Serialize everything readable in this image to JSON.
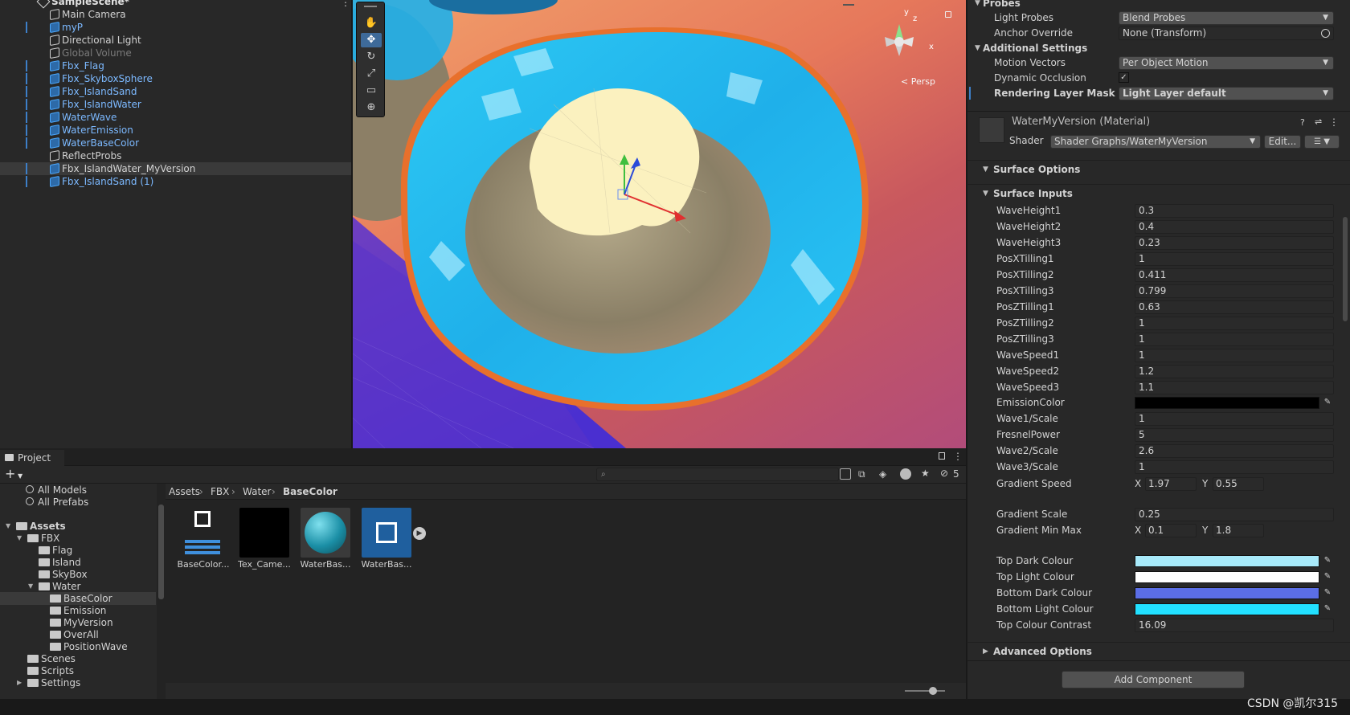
{
  "hierarchy": {
    "scene_name": "SampleScene*",
    "items": [
      {
        "label": "Main Camera",
        "style": "normal"
      },
      {
        "label": "myP",
        "style": "blue"
      },
      {
        "label": "Directional Light",
        "style": "normal"
      },
      {
        "label": "Global Volume",
        "style": "gray"
      },
      {
        "label": "Fbx_Flag",
        "style": "blue"
      },
      {
        "label": "Fbx_SkyboxSphere",
        "style": "blue"
      },
      {
        "label": "Fbx_IslandSand",
        "style": "blue"
      },
      {
        "label": "Fbx_IslandWater",
        "style": "blue"
      },
      {
        "label": "WaterWave",
        "style": "blue"
      },
      {
        "label": "WaterEmission",
        "style": "blue"
      },
      {
        "label": "WaterBaseColor",
        "style": "blue"
      },
      {
        "label": "ReflectProbs",
        "style": "normal"
      },
      {
        "label": "Fbx_IslandWater_MyVersion",
        "style": "selected"
      },
      {
        "label": "Fbx_IslandSand (1)",
        "style": "blue"
      }
    ]
  },
  "scene": {
    "persp_label": "< Persp",
    "gizmo_axes": [
      "y",
      "z",
      "x"
    ],
    "tool_icons": [
      "hand-icon",
      "move-icon",
      "rotate-icon",
      "scale-icon",
      "rect-icon",
      "transform-icon"
    ]
  },
  "project": {
    "tab_label": "Project",
    "add_label": "+",
    "hidden_count": "5",
    "tree": [
      {
        "label": "All Models",
        "type": "search",
        "indent": 0
      },
      {
        "label": "All Prefabs",
        "type": "search",
        "indent": 0
      },
      {
        "label": "Assets",
        "type": "folder",
        "indent": 0,
        "bold": true
      },
      {
        "label": "FBX",
        "type": "folder",
        "indent": 1
      },
      {
        "label": "Flag",
        "type": "folder",
        "indent": 2
      },
      {
        "label": "Island",
        "type": "folder",
        "indent": 2
      },
      {
        "label": "SkyBox",
        "type": "folder",
        "indent": 2
      },
      {
        "label": "Water",
        "type": "folder",
        "indent": 2
      },
      {
        "label": "BaseColor",
        "type": "folder",
        "indent": 3,
        "selected": true
      },
      {
        "label": "Emission",
        "type": "folder",
        "indent": 3
      },
      {
        "label": "MyVersion",
        "type": "folder",
        "indent": 3
      },
      {
        "label": "OverAll",
        "type": "folder",
        "indent": 3
      },
      {
        "label": "PositionWave",
        "type": "folder",
        "indent": 3
      },
      {
        "label": "Scenes",
        "type": "folder",
        "indent": 1
      },
      {
        "label": "Scripts",
        "type": "folder",
        "indent": 1
      },
      {
        "label": "Settings",
        "type": "folder",
        "indent": 1
      }
    ],
    "breadcrumb": [
      "Assets",
      "FBX",
      "Water",
      "BaseColor"
    ],
    "assets": [
      {
        "name": "BaseColor...",
        "kind": "shadergraph"
      },
      {
        "name": "Tex_Came...",
        "kind": "texture"
      },
      {
        "name": "WaterBas...",
        "kind": "material"
      },
      {
        "name": "WaterBas...",
        "kind": "shadergraph-selected"
      }
    ]
  },
  "inspector": {
    "probes_header": "Probes",
    "light_probes_label": "Light Probes",
    "light_probes_value": "Blend Probes",
    "anchor_override_label": "Anchor Override",
    "anchor_override_value": "None (Transform)",
    "additional_header": "Additional Settings",
    "motion_vectors_label": "Motion Vectors",
    "motion_vectors_value": "Per Object Motion",
    "dynamic_occlusion_label": "Dynamic Occlusion",
    "dynamic_occlusion_checked": true,
    "rendering_layer_label": "Rendering Layer Mask",
    "rendering_layer_value": "Light Layer default",
    "material_name": "WaterMyVersion (Material)",
    "shader_label": "Shader",
    "shader_value": "Shader Graphs/WaterMyVersion",
    "edit_label": "Edit...",
    "surface_options": "Surface Options",
    "surface_inputs": "Surface Inputs",
    "fields": [
      {
        "label": "WaveHeight1",
        "value": "0.3"
      },
      {
        "label": "WaveHeight2",
        "value": "0.4"
      },
      {
        "label": "WaveHeight3",
        "value": "0.23"
      },
      {
        "label": "PosXTilling1",
        "value": "1"
      },
      {
        "label": "PosXTilling2",
        "value": "0.411"
      },
      {
        "label": "PosXTilling3",
        "value": "0.799"
      },
      {
        "label": "PosZTilling1",
        "value": "0.63"
      },
      {
        "label": "PosZTilling2",
        "value": "1"
      },
      {
        "label": "PosZTilling3",
        "value": "1"
      },
      {
        "label": "WaveSpeed1",
        "value": "1"
      },
      {
        "label": "WaveSpeed2",
        "value": "1.2"
      },
      {
        "label": "WaveSpeed3",
        "value": "1.1"
      }
    ],
    "emission_label": "EmissionColor",
    "emission_color": "#000000",
    "fields2": [
      {
        "label": "Wave1/Scale",
        "value": "1"
      },
      {
        "label": "FresnelPower",
        "value": "5"
      },
      {
        "label": "Wave2/Scale",
        "value": "2.6"
      },
      {
        "label": "Wave3/Scale",
        "value": "1"
      }
    ],
    "gradient_speed_label": "Gradient Speed",
    "gradient_speed_x": "1.97",
    "gradient_speed_y": "0.55",
    "gradient_scale_label": "Gradient Scale",
    "gradient_scale_value": "0.25",
    "gradient_minmax_label": "Gradient Min Max",
    "gradient_minmax_x": "0.1",
    "gradient_minmax_y": "1.8",
    "x_label": "X",
    "y_label": "Y",
    "colours": [
      {
        "label": "Top Dark Colour",
        "color": "#a8eafa"
      },
      {
        "label": "Top Light Colour",
        "color": "#ffffff"
      },
      {
        "label": "Bottom Dark Colour",
        "color": "#5b6ee6"
      },
      {
        "label": "Bottom Light Colour",
        "color": "#22e0ff"
      }
    ],
    "contrast_label": "Top Colour Contrast",
    "contrast_value": "16.09",
    "advanced_options": "Advanced Options",
    "add_component": "Add Component"
  },
  "watermark": "CSDN @凯尔315"
}
